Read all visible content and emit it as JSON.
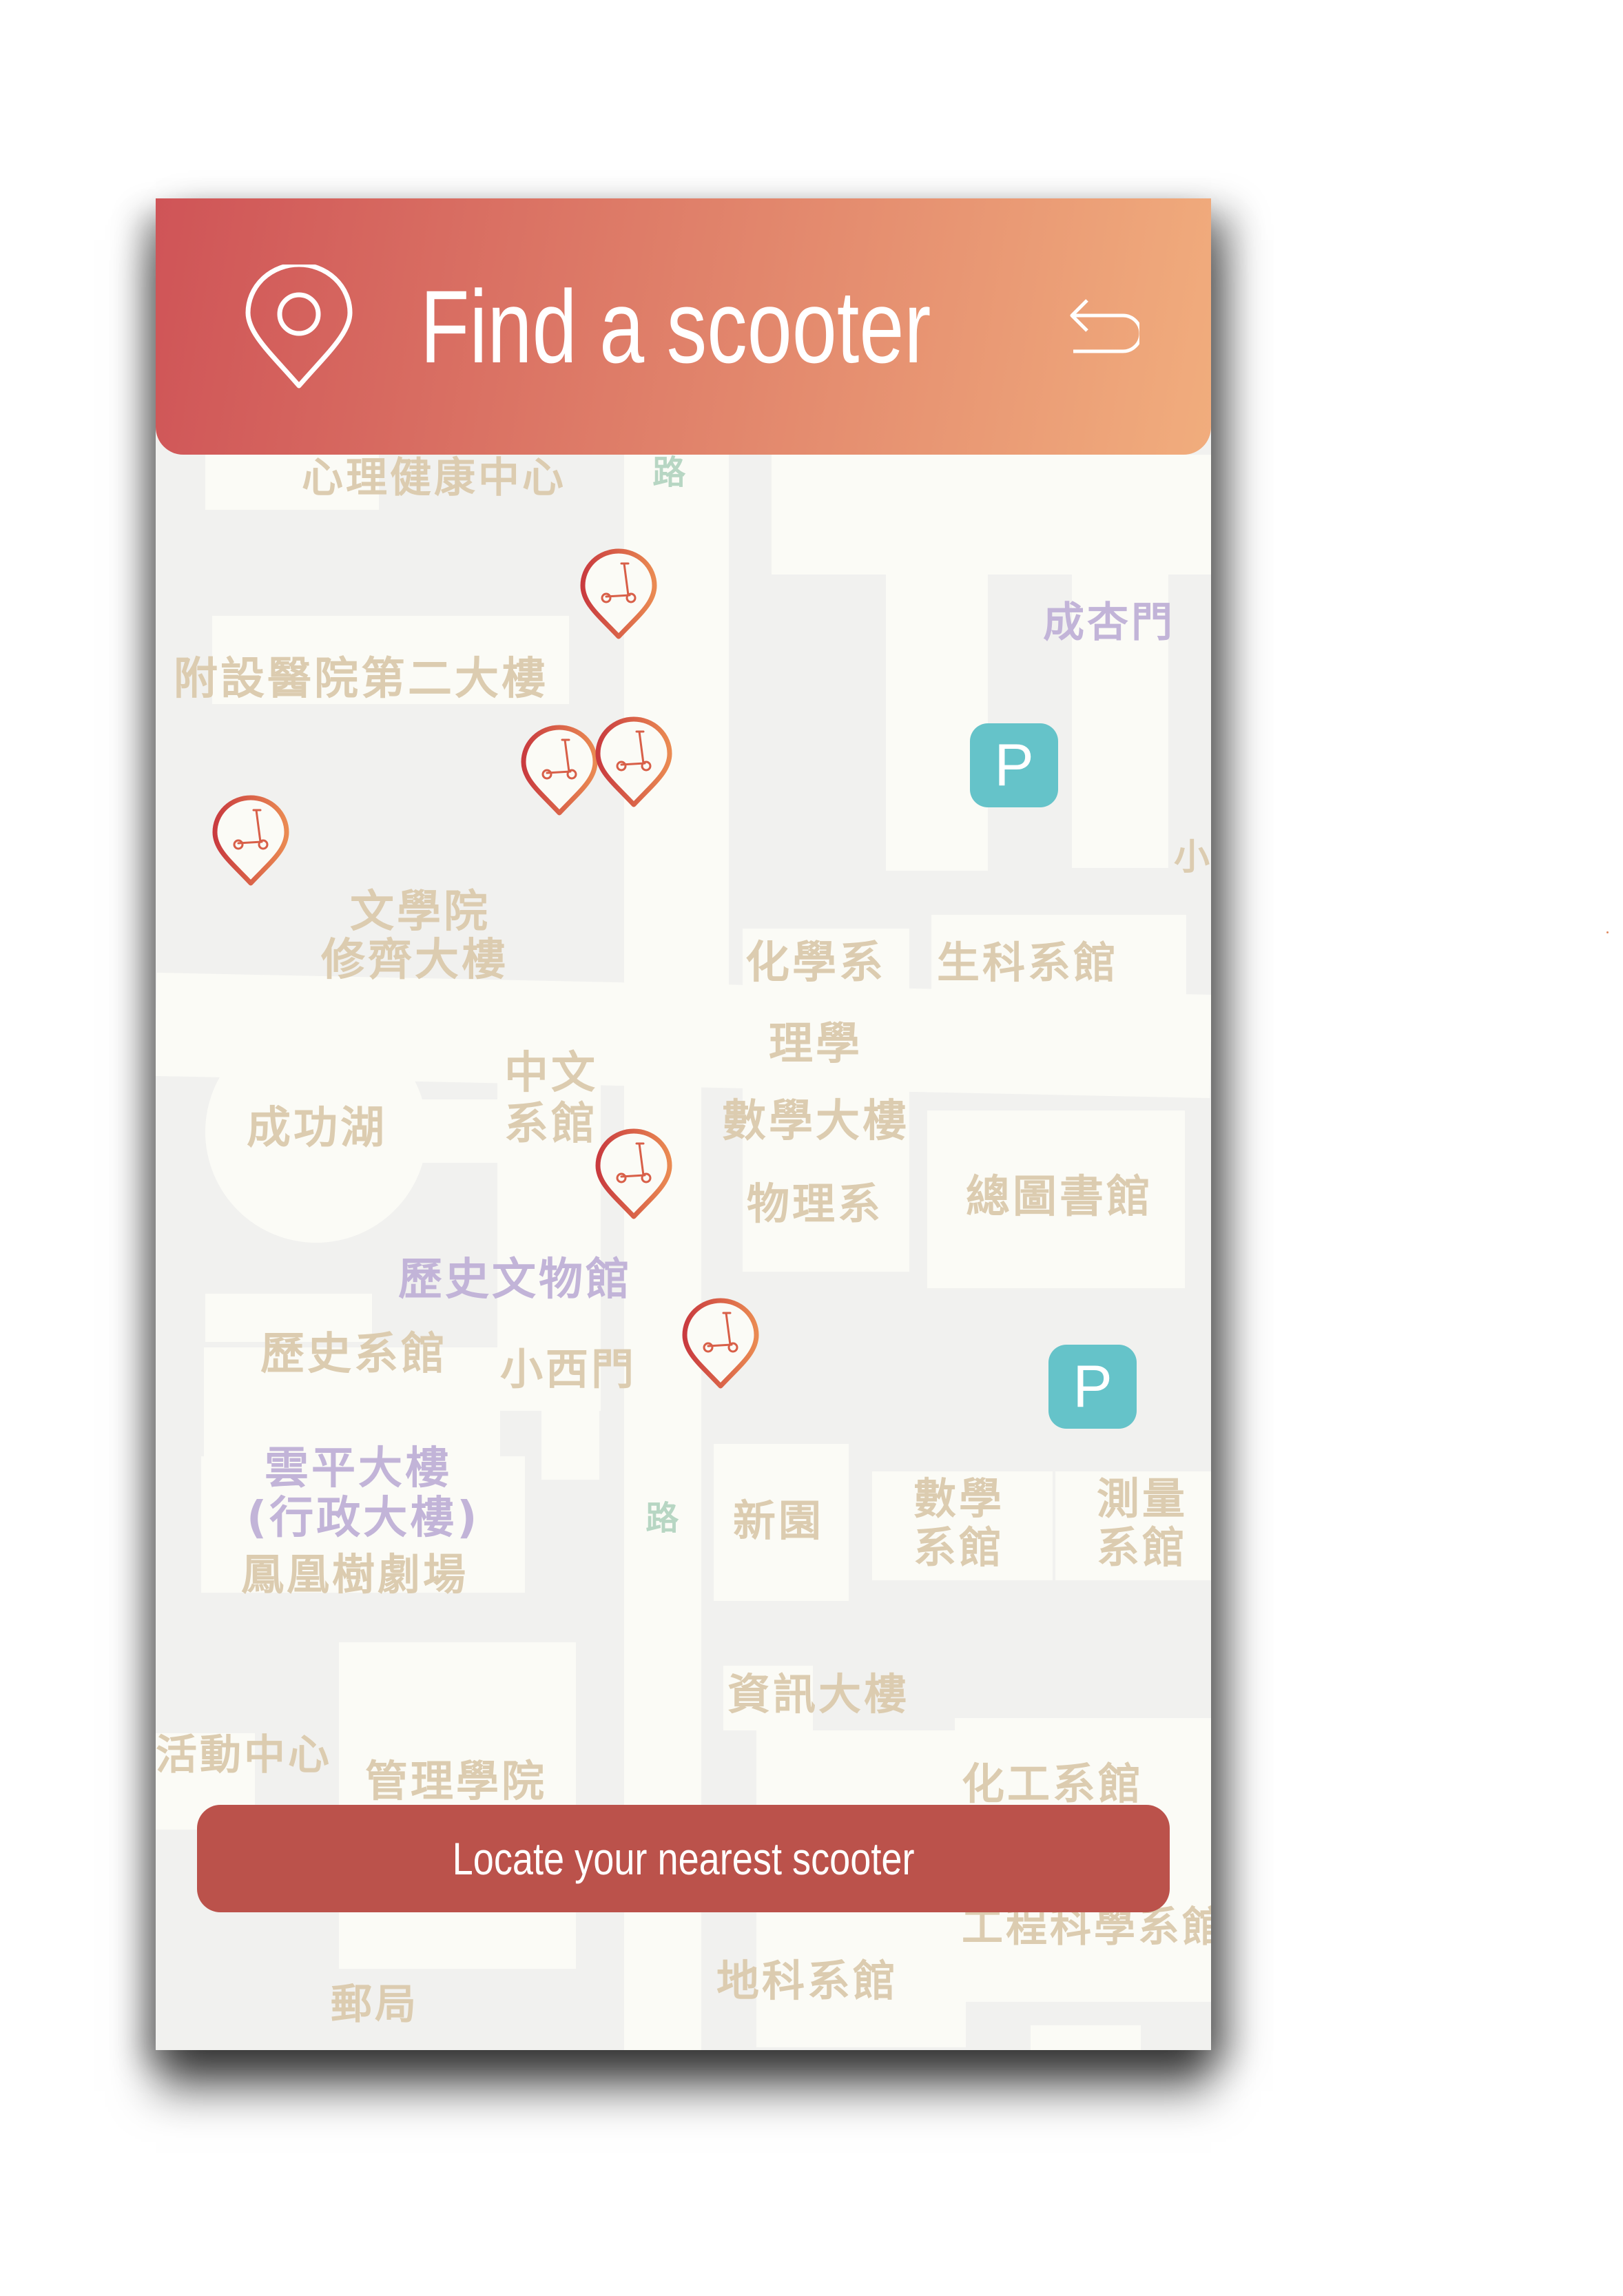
{
  "header": {
    "title": "Find a scooter",
    "gradient": [
      "#cf5457",
      "#f1ad7d"
    ]
  },
  "map": {
    "labels": {
      "mental_health": "心理健康中心",
      "hospital2": "附設醫院第二大樓",
      "chengxing_gate": "成杏門",
      "liberal_arts": "文學院",
      "xiuqi": "修齊大樓",
      "chemistry": "化學系",
      "biotech": "生科系館",
      "chinese": "中文系館",
      "science": "理學",
      "math_bldg": "數學大樓",
      "physics": "物理系",
      "library": "總圖書館",
      "cheng_lake": "成功湖",
      "history_museum": "歷史文物館",
      "history_dept": "歷史系館",
      "xiaoximen": "小西門",
      "yunping": "雲平大樓",
      "admin": "(行政大樓)",
      "phoenix": "鳳凰樹劇場",
      "xinyuan": "新園",
      "math_dept": "數學系館",
      "survey_dept": "測量系館",
      "info_bldg": "資訊大樓",
      "activity": "活動中心",
      "management": "管理學院",
      "chem_eng": "化工系館",
      "engsci": "工程科學系館",
      "earth_sci": "地科系館",
      "post_office": "郵局",
      "small": "小"
    },
    "parking_label": "P",
    "parking_color": "#65c3c9",
    "scooter_pins": 6
  },
  "locate_button": {
    "label": "Locate your nearest scooter",
    "color": "#bb524b"
  }
}
